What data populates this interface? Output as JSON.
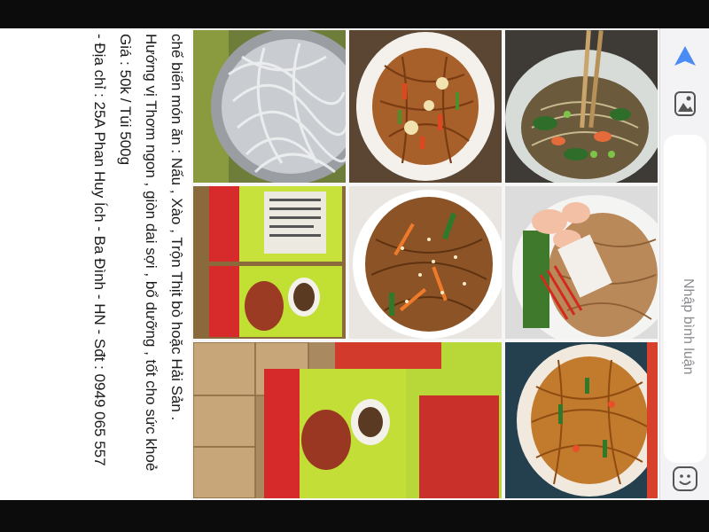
{
  "post": {
    "lines": [
      "chế biến món ăn : Nấu , Xào , Trộn Thịt bò hoặc Hải Sản .",
      "Hướng vị Thơm ngon , giòn dai sợi , bổ dưỡng , tốt cho sức khoẻ",
      "Giá : 50k / Túi 500g",
      "- Địa chỉ : 25A Phan Huy Ích - Ba Đình - HN - Sđt : 0949 065 557"
    ]
  },
  "photos": [
    {
      "name": "photo-raw-glass-noodles"
    },
    {
      "name": "photo-stirfried-noodles-plate"
    },
    {
      "name": "photo-noodles-chopsticks"
    },
    {
      "name": "photo-noodle-packages"
    },
    {
      "name": "photo-sesame-noodles"
    },
    {
      "name": "photo-shrimp-squid-noodles"
    },
    {
      "name": "photo-packages-boxes"
    },
    {
      "name": "photo-stirfried-noodles-closeup"
    }
  ],
  "comment_bar": {
    "placeholder": "Nhập bình luận",
    "icons": [
      "send-icon",
      "media-icon",
      "emoji-icon"
    ],
    "accent": "#4a8bf5"
  }
}
